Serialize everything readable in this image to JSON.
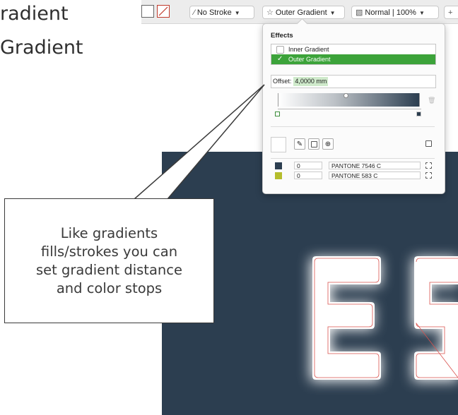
{
  "background_text": {
    "line1": "radient",
    "line2": "Gradient"
  },
  "toolbar": {
    "stroke_label": "No Stroke",
    "effect_label": "Outer Gradient",
    "blend_label": "Normal | 100%"
  },
  "popover": {
    "title": "Effects",
    "effects": [
      {
        "label": "Inner Gradient",
        "checked": false,
        "selected": false
      },
      {
        "label": "Outer Gradient",
        "checked": true,
        "selected": true
      }
    ],
    "offset_label": "Offset:",
    "offset_value": "4,0000 mm",
    "midpoint_percent": 48,
    "stops": [
      {
        "position": "0",
        "name": "PANTONE 7546 C",
        "color": "#2c3e50"
      },
      {
        "position": "0",
        "name": "PANTONE 583 C",
        "color": "#b5bd2c"
      }
    ]
  },
  "callout": {
    "text": "Like gradients\nfills/strokes you can\nset gradient distance\nand color stops"
  },
  "canvas": {
    "letters": "ES",
    "background_color": "#2c3e50"
  },
  "colors": {
    "accent_green": "#3ca33a",
    "dark_navy": "#2c3e50",
    "stop_yellow": "#b5bd2c"
  }
}
